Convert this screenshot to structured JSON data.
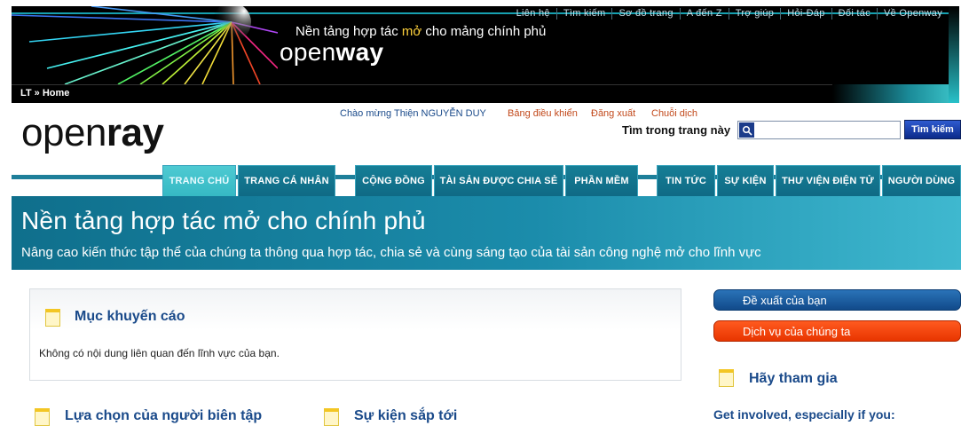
{
  "banner": {
    "top_links": [
      "Liên hệ",
      "Tìm kiếm",
      "Sơ đồ trang",
      "A đến Z",
      "Trợ giúp",
      "Hỏi-Đáp",
      "Đối tác",
      "Về Openway"
    ],
    "tagline_pre": "Nền tảng hợp tác ",
    "tagline_highlight": "mở",
    "tagline_post": " cho mảng chính phủ",
    "logo_regular": "open",
    "logo_bold": "way",
    "breadcrumb": "LT » Home"
  },
  "header": {
    "logo_regular": "open",
    "logo_bold": "ray",
    "welcome": "Chào mừng Thiện NGUYỄN DUY",
    "dashboard": "Bảng điều khiển",
    "logout": "Đăng xuất",
    "translate": "Chuỗi dịch",
    "search_label": "Tìm trong trang này",
    "search_value": "",
    "search_button": "Tìm kiếm"
  },
  "nav": {
    "tabs": [
      {
        "label": "TRANG CHỦ",
        "active": true
      },
      {
        "label": "TRANG CÁ NHÂN",
        "active": false
      },
      {
        "label": "CỘNG ĐỒNG",
        "active": false
      },
      {
        "label": "TÀI SẢN ĐƯỢC CHIA SẺ",
        "active": false
      },
      {
        "label": "PHẦN MỀM",
        "active": false
      },
      {
        "label": "TIN TỨC",
        "active": false
      },
      {
        "label": "SỰ KIỆN",
        "active": false
      },
      {
        "label": "THƯ VIỆN ĐIỆN TỬ",
        "active": false
      },
      {
        "label": "NGƯỜI DÙNG",
        "active": false
      }
    ]
  },
  "hero": {
    "title": "Nền tảng hợp tác mở cho chính phủ",
    "subtitle": "Nâng cao kiến thức tập thể của chúng ta thông qua hợp tác, chia sẻ và cùng sáng tạo của tài sản công nghệ mở cho lĩnh vực"
  },
  "main": {
    "recommend_title": "Mục khuyến cáo",
    "recommend_body": "Không có nội dung liên quan đến lĩnh vực của bạn.",
    "editor_picks_title": "Lựa chọn của người biên tập",
    "upcoming_events_title": "Sự kiện sắp tới"
  },
  "sidebar": {
    "suggest_button": "Đề xuất của bạn",
    "services_button": "Dịch vụ của chúng ta",
    "join_title": "Hãy tham gia",
    "get_involved": "Get involved, especially if you:"
  },
  "colors": {
    "accent_teal": "#1b8cab",
    "link_blue": "#1a4a8a",
    "link_orange": "#c2491b",
    "services_orange": "#ff4a10"
  }
}
